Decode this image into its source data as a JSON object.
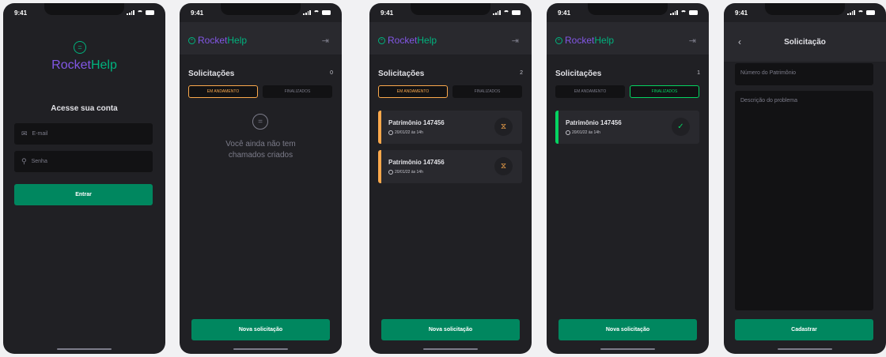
{
  "status": {
    "time": "9:41"
  },
  "brand": {
    "rocket": "Rocket",
    "help": "Help"
  },
  "login": {
    "title": "Acesse sua conta",
    "email_placeholder": "E-mail",
    "password_placeholder": "Senha",
    "submit": "Entrar"
  },
  "list": {
    "title": "Solicitações",
    "tab_open": "EM ANDAMENTO",
    "tab_closed": "FINALIZADOS",
    "new_button": "Nova solicitação",
    "empty_line1": "Você ainda não tem",
    "empty_line2": "chamados criados"
  },
  "screens": {
    "empty": {
      "count": "0"
    },
    "open": {
      "count": "2",
      "cards": [
        {
          "title": "Patrimônio 147456",
          "date": "20/01/22 às 14h"
        },
        {
          "title": "Patrimônio 147456",
          "date": "20/01/22 às 14h"
        }
      ]
    },
    "closed": {
      "count": "1",
      "cards": [
        {
          "title": "Patrimônio 147456",
          "date": "20/01/22 às 14h"
        }
      ]
    }
  },
  "form": {
    "title": "Solicitação",
    "patrimony_placeholder": "Número do Patrimônio",
    "description_placeholder": "Descrição do problema",
    "submit": "Cadastrar"
  },
  "colors": {
    "primary": "#00875f",
    "brand_purple": "#8257e5",
    "open": "#fba94c",
    "closed": "#04d361"
  }
}
